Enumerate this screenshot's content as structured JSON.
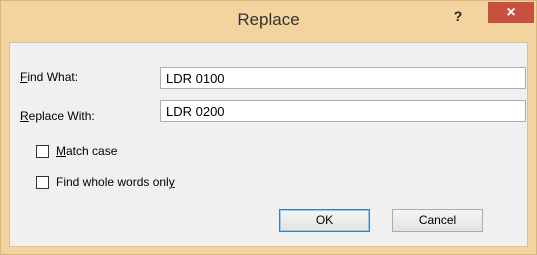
{
  "window": {
    "title": "Replace",
    "help_label": "?",
    "close_label": "×"
  },
  "form": {
    "find_label_hot": "F",
    "find_label_rest": "ind What:",
    "find_value": "LDR 0100",
    "replace_label_hot": "R",
    "replace_label_rest": "eplace With:",
    "replace_value": "LDR 0200"
  },
  "options": {
    "match_case_hot": "M",
    "match_case_rest": "atch case",
    "match_case_checked": false,
    "whole_words_pre": "Find whole words onl",
    "whole_words_hot": "y",
    "whole_words_checked": false
  },
  "buttons": {
    "ok_label": "OK",
    "cancel_label": "Cancel"
  }
}
